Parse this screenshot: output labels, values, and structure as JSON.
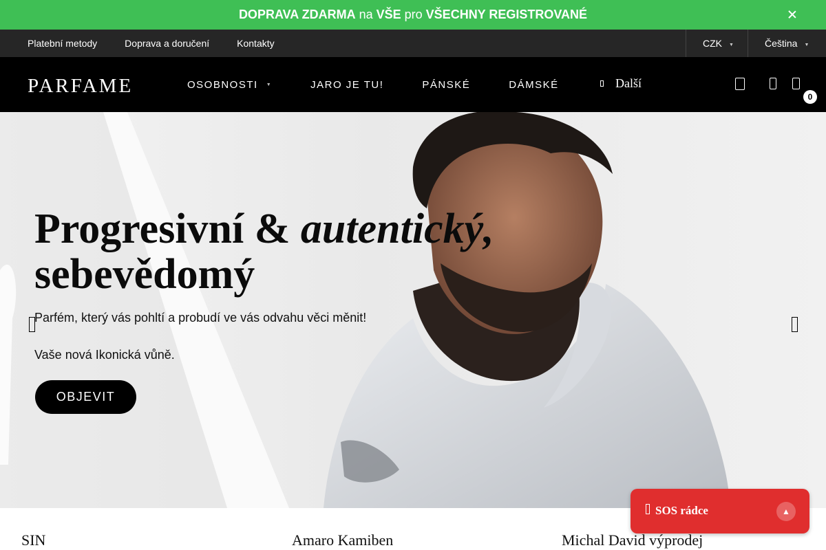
{
  "promo": {
    "part1": "DOPRAVA ZDARMA",
    "part2": "na",
    "part3": "VŠE",
    "part4": "pro",
    "part5": "VŠECHNY REGISTROVANÉ"
  },
  "util": {
    "links": [
      "Platební metody",
      "Doprava a doručení",
      "Kontakty"
    ],
    "currency": "CZK",
    "language": "Čeština"
  },
  "nav": {
    "logo": "PARFAME",
    "items": [
      "OSOBNOSTI",
      "JARO JE TU!",
      "PÁNSKÉ",
      "DÁMSKÉ"
    ],
    "more": "Další",
    "cart_count": "0"
  },
  "hero": {
    "title_a": "Progresivní & ",
    "title_b": "autentický,",
    "title_c": "sebevědomý",
    "subtitle": "Parfém, který vás pohltí a probudí ve vás odvahu věci měnit!",
    "subtitle2": "Vaše nová Ikonická vůně.",
    "button": "OBJEVIT"
  },
  "categories": [
    "SIN",
    "Amaro Kamiben",
    "Michal David výprodej"
  ],
  "sos": {
    "label": "SOS rádce",
    "up_icon": "▲"
  },
  "colors": {
    "promo": "#3fbf55",
    "util": "#262626",
    "nav": "#000000",
    "sos": "#e02e2e"
  }
}
